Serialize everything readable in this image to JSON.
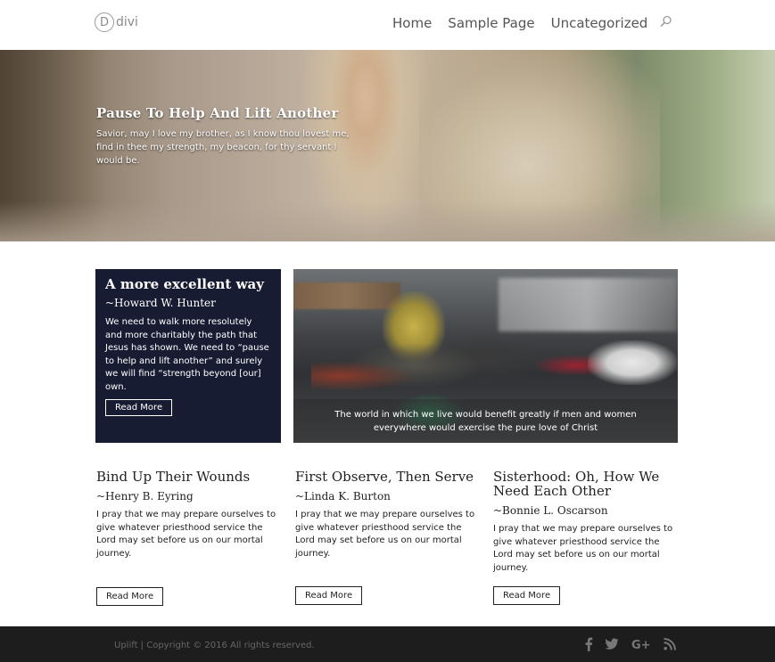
{
  "header": {
    "logo_mark": "D",
    "logo_text": "divi",
    "nav": [
      "Home",
      "Sample Page",
      "Uncategorized"
    ],
    "search_icon": "search-icon"
  },
  "hero": {
    "title": "Pause To Help And Lift Another",
    "text": "Savior, may I love my brother, as I know thou lovest me, find in thee my strength, my beacon, for thy servant I would be."
  },
  "feature": {
    "title": "A more excellent way",
    "author": "~Howard W. Hunter",
    "text": "We need to walk more resolutely and more charitably the path that Jesus has shown. We need to “pause to help and lift another” and surely we will find “strength beyond [our] own.",
    "button": "Read More"
  },
  "photo": {
    "caption": "The world in which we live would benefit greatly if men and women everywhere would exercise the pure love of Christ"
  },
  "columns": [
    {
      "title": "Bind Up Their Wounds",
      "author": "~Henry B. Eyring",
      "text": "I pray that we may prepare ourselves to give whatever priesthood service the Lord may set before us on our mortal journey.",
      "button": "Read More"
    },
    {
      "title": "First Observe, Then Serve",
      "author": "~Linda K. Burton",
      "text": "I pray that we may prepare ourselves to give whatever priesthood service the Lord may set before us on our mortal journey.",
      "button": "Read More"
    },
    {
      "title": "Sisterhood: Oh, How We Need Each Other",
      "author": "~Bonnie L. Oscarson",
      "text": "I pray that we may prepare ourselves to give whatever priesthood service the Lord may set before us on our mortal journey.",
      "button": "Read More"
    }
  ],
  "footer": {
    "copyright": "Uplift | Copyright © 2016 All rights reserved.",
    "social_icons": [
      "facebook-icon",
      "twitter-icon",
      "google-plus-icon",
      "rss-icon"
    ]
  },
  "colors": {
    "card_background": "#171c33",
    "footer_background": "#1d1d1d",
    "footer_text": "#666666",
    "nav_text": "#555555"
  }
}
